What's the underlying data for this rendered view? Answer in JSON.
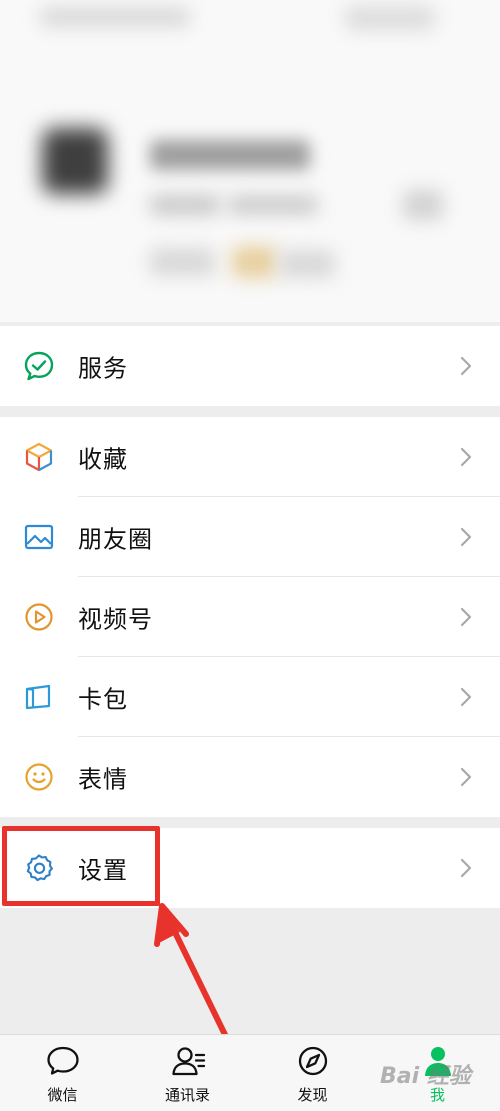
{
  "menu": {
    "service": "服务",
    "favorites": "收藏",
    "moments": "朋友圈",
    "channels": "视频号",
    "cards": "卡包",
    "stickers": "表情",
    "settings": "设置"
  },
  "tabbar": {
    "chats": "微信",
    "contacts": "通讯录",
    "discover": "发现",
    "me": "我",
    "active": "me"
  },
  "watermark": "Bai 经验",
  "colors": {
    "accent": "#07c160",
    "highlight": "#e8332c",
    "arrow": "#e8332c"
  }
}
